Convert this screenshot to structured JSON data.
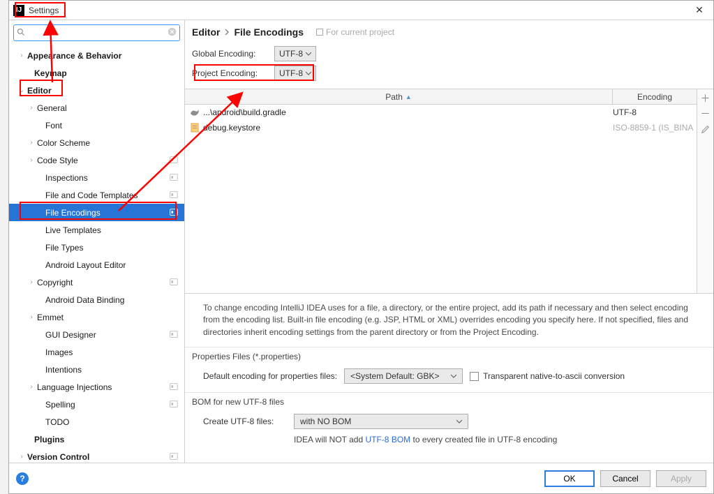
{
  "title": "Settings",
  "search": {
    "placeholder": ""
  },
  "sidebar": {
    "items": [
      {
        "label": "Appearance & Behavior",
        "indent": 26,
        "expand": "›",
        "bold": true
      },
      {
        "label": "Keymap",
        "indent": 36,
        "expand": "",
        "bold": true
      },
      {
        "label": "Editor",
        "indent": 26,
        "expand": "⌄",
        "bold": true
      },
      {
        "label": "General",
        "indent": 40,
        "expand": "›"
      },
      {
        "label": "Font",
        "indent": 52,
        "expand": ""
      },
      {
        "label": "Color Scheme",
        "indent": 40,
        "expand": "›"
      },
      {
        "label": "Code Style",
        "indent": 40,
        "expand": "›",
        "proj": true
      },
      {
        "label": "Inspections",
        "indent": 52,
        "expand": "",
        "proj": true
      },
      {
        "label": "File and Code Templates",
        "indent": 52,
        "expand": "",
        "proj": true
      },
      {
        "label": "File Encodings",
        "indent": 52,
        "expand": "",
        "proj": true,
        "selected": true
      },
      {
        "label": "Live Templates",
        "indent": 52,
        "expand": ""
      },
      {
        "label": "File Types",
        "indent": 52,
        "expand": ""
      },
      {
        "label": "Android Layout Editor",
        "indent": 52,
        "expand": ""
      },
      {
        "label": "Copyright",
        "indent": 40,
        "expand": "›",
        "proj": true
      },
      {
        "label": "Android Data Binding",
        "indent": 52,
        "expand": ""
      },
      {
        "label": "Emmet",
        "indent": 40,
        "expand": "›"
      },
      {
        "label": "GUI Designer",
        "indent": 52,
        "expand": "",
        "proj": true
      },
      {
        "label": "Images",
        "indent": 52,
        "expand": ""
      },
      {
        "label": "Intentions",
        "indent": 52,
        "expand": ""
      },
      {
        "label": "Language Injections",
        "indent": 40,
        "expand": "›",
        "proj": true
      },
      {
        "label": "Spelling",
        "indent": 52,
        "expand": "",
        "proj": true
      },
      {
        "label": "TODO",
        "indent": 52,
        "expand": ""
      },
      {
        "label": "Plugins",
        "indent": 36,
        "expand": "",
        "bold": true
      },
      {
        "label": "Version Control",
        "indent": 26,
        "expand": "›",
        "bold": true,
        "proj": true
      }
    ]
  },
  "breadcrumb": {
    "a": "Editor",
    "b": "File Encodings",
    "note": "For current project"
  },
  "globalEncoding": {
    "label": "Global Encoding:",
    "value": "UTF-8"
  },
  "projectEncoding": {
    "label": "Project Encoding:",
    "value": "UTF-8"
  },
  "table": {
    "head_path": "Path",
    "head_enc": "Encoding",
    "rows": [
      {
        "path": "...\\android\\build.gradle",
        "enc": "UTF-8",
        "muted": false,
        "icon": "gradle"
      },
      {
        "path": "debug.keystore",
        "enc": "ISO-8859-1 (IS_BINA",
        "muted": true,
        "icon": "file"
      }
    ]
  },
  "helpText": "To change encoding IntelliJ IDEA uses for a file, a directory, or the entire project, add its path if necessary and then select encoding from the encoding list. Built-in file encoding (e.g. JSP, HTML or XML) overrides encoding you specify here. If not specified, files and directories inherit encoding settings from the parent directory or from the Project Encoding.",
  "propsSection": {
    "title": "Properties Files (*.properties)",
    "defaultLabel": "Default encoding for properties files:",
    "defaultValue": "<System Default: GBK>",
    "transparentLabel": "Transparent native-to-ascii conversion"
  },
  "bomSection": {
    "title": "BOM for new UTF-8 files",
    "createLabel": "Create UTF-8 files:",
    "createValue": "with NO BOM",
    "notePre": "IDEA will NOT add ",
    "noteLink": "UTF-8 BOM",
    "notePost": " to every created file in UTF-8 encoding"
  },
  "buttons": {
    "ok": "OK",
    "cancel": "Cancel",
    "apply": "Apply"
  }
}
